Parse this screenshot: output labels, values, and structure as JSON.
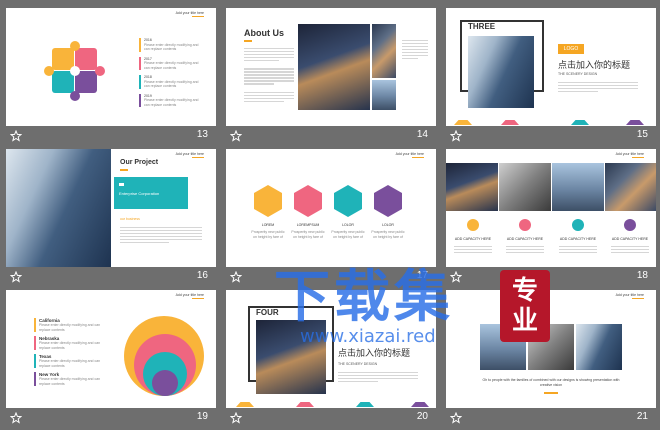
{
  "header_text": "Add your title here",
  "slides": [
    {
      "num": "13",
      "list_labels": [
        "2016",
        "2017",
        "2018",
        "2019"
      ],
      "body": "Please enter directly modifying and can replace contents"
    },
    {
      "num": "14",
      "title": "About Us"
    },
    {
      "num": "15",
      "title": "THREE",
      "logo": "LOGO",
      "headline": "点击加入你的标题",
      "sub": "THE SCENERY DESIGN"
    },
    {
      "num": "16",
      "title": "Our Project",
      "tag": "Enterprise Corporation",
      "sub": "our business"
    },
    {
      "num": "17",
      "labels": [
        "LOREM",
        "LOREMPSUM",
        "LOLOR",
        "LOLOR"
      ],
      "body": "Prosperity new public on height by fare of"
    },
    {
      "num": "18",
      "labels": [
        "ADD CAPACITY HERE",
        "ADD CAPACITY HERE",
        "ADD CAPACITY HERE",
        "ADD CAPACITY HERE"
      ]
    },
    {
      "num": "19",
      "states": [
        "California",
        "Nebraska",
        "Texas",
        "New York"
      ],
      "body": "Please enter directly modifying and can replace contents"
    },
    {
      "num": "20",
      "title": "FOUR",
      "headline": "点击加入你的标题",
      "sub": "THE SCENERY DESIGN"
    },
    {
      "num": "21",
      "caption": "Oh to people with the families of combined with our designs is showing presentation with creative vision"
    }
  ],
  "watermark": {
    "main": "下载集",
    "seal": "专业",
    "url": "www.xiazai.red"
  },
  "colors": {
    "yellow": "#f9b43a",
    "pink": "#ef6680",
    "teal": "#1fb3b8",
    "purple": "#7a4f9c",
    "footer": "#5c5c5c",
    "accent": "#f5a623"
  }
}
